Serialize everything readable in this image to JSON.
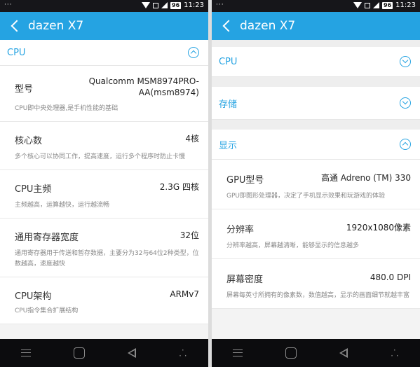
{
  "status_bar": {
    "dots": "···",
    "battery": "96",
    "time": "11:23"
  },
  "app_title": "dazen X7",
  "left": {
    "section_title": "CPU",
    "items": [
      {
        "label": "型号",
        "value_line1": "Qualcomm MSM8974PRO-",
        "value_line2": "AA(msm8974)",
        "desc": "CPU即中央处理器,是手机性能的基础"
      },
      {
        "label": "核心数",
        "value": "4核",
        "desc": "多个核心可以协同工作，提高速度，运行多个程序时防止卡慢"
      },
      {
        "label": "CPU主频",
        "value": "2.3G 四核",
        "desc": "主频越高，运算越快，运行越流畅"
      },
      {
        "label": "通用寄存器宽度",
        "value": "32位",
        "desc": "通用寄存器用于传送和暂存数据，主要分为32与64位2种类型，位数越高，速度越快"
      },
      {
        "label": "CPU架构",
        "value": "ARMv7",
        "desc": "CPU指令集合扩展结构"
      }
    ]
  },
  "right": {
    "sections": [
      {
        "title": "CPU"
      },
      {
        "title": "存储"
      },
      {
        "title": "显示"
      }
    ],
    "items": [
      {
        "label": "GPU型号",
        "value": "高通 Adreno (TM) 330",
        "desc": "GPU即图形处理器，决定了手机显示效果和玩游戏的体验"
      },
      {
        "label": "分辨率",
        "value": "1920x1080像素",
        "desc": "分辨率越高，屏幕越清晰，能够显示的信息越多"
      },
      {
        "label": "屏幕密度",
        "value": "480.0 DPI",
        "desc": "屏幕每英寸所拥有的像素数，数值越高，显示的画面细节就越丰富"
      }
    ]
  },
  "icons": [
    "back-icon",
    "chevron-up-icon",
    "chevron-down-icon",
    "wifi-icon",
    "signal-icon",
    "battery-icon",
    "menu-icon",
    "home-icon",
    "back-nav-icon",
    "more-icon"
  ],
  "colors": {
    "accent": "#25a3e2",
    "status_bar": "#16161a",
    "nav_bar": "#0c0c0e"
  }
}
